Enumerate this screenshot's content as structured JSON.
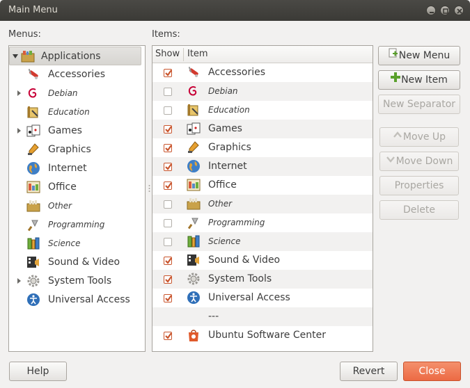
{
  "window": {
    "title": "Main Menu"
  },
  "menus_label": "Menus:",
  "items_label": "Items:",
  "menus": {
    "root": {
      "label": "Applications",
      "icon": "applications-folder-icon",
      "expanded": true
    },
    "children": [
      {
        "label": "Accessories",
        "icon": "accessories-icon",
        "italic": false,
        "expander": false
      },
      {
        "label": "Debian",
        "icon": "debian-swirl-icon",
        "italic": true,
        "expander": true
      },
      {
        "label": "Education",
        "icon": "education-icon",
        "italic": true,
        "expander": false
      },
      {
        "label": "Games",
        "icon": "games-cards-icon",
        "italic": false,
        "expander": true
      },
      {
        "label": "Graphics",
        "icon": "graphics-icon",
        "italic": false,
        "expander": false
      },
      {
        "label": "Internet",
        "icon": "internet-globe-icon",
        "italic": false,
        "expander": false
      },
      {
        "label": "Office",
        "icon": "office-icon",
        "italic": false,
        "expander": false
      },
      {
        "label": "Other",
        "icon": "other-folder-icon",
        "italic": true,
        "expander": false
      },
      {
        "label": "Programming",
        "icon": "programming-trowel-icon",
        "italic": true,
        "expander": false
      },
      {
        "label": "Science",
        "icon": "science-icon",
        "italic": true,
        "expander": false
      },
      {
        "label": "Sound & Video",
        "icon": "sound-video-icon",
        "italic": false,
        "expander": false
      },
      {
        "label": "System Tools",
        "icon": "system-tools-gear-icon",
        "italic": false,
        "expander": true
      },
      {
        "label": "Universal Access",
        "icon": "universal-access-icon",
        "italic": false,
        "expander": false
      }
    ]
  },
  "items": {
    "columns": {
      "show": "Show",
      "item": "Item"
    },
    "rows": [
      {
        "show": true,
        "label": "Accessories",
        "icon": "accessories-icon",
        "italic": false
      },
      {
        "show": false,
        "label": "Debian",
        "icon": "debian-swirl-icon",
        "italic": true
      },
      {
        "show": false,
        "label": "Education",
        "icon": "education-icon",
        "italic": true
      },
      {
        "show": true,
        "label": "Games",
        "icon": "games-cards-icon",
        "italic": false
      },
      {
        "show": true,
        "label": "Graphics",
        "icon": "graphics-icon",
        "italic": false
      },
      {
        "show": true,
        "label": "Internet",
        "icon": "internet-globe-icon",
        "italic": false
      },
      {
        "show": true,
        "label": "Office",
        "icon": "office-icon",
        "italic": false
      },
      {
        "show": false,
        "label": "Other",
        "icon": "other-folder-icon",
        "italic": true
      },
      {
        "show": false,
        "label": "Programming",
        "icon": "programming-trowel-icon",
        "italic": true
      },
      {
        "show": false,
        "label": "Science",
        "icon": "science-icon",
        "italic": true
      },
      {
        "show": true,
        "label": "Sound & Video",
        "icon": "sound-video-icon",
        "italic": false
      },
      {
        "show": true,
        "label": "System Tools",
        "icon": "system-tools-gear-icon",
        "italic": false
      },
      {
        "show": true,
        "label": "Universal Access",
        "icon": "universal-access-icon",
        "italic": false
      },
      {
        "separator": true,
        "label": "---"
      },
      {
        "show": true,
        "label": "Ubuntu Software Center",
        "icon": "software-center-bag-icon",
        "italic": false
      }
    ]
  },
  "buttons": {
    "new_menu": "New Menu",
    "new_item": "New Item",
    "new_separator": "New Separator",
    "move_up": "Move Up",
    "move_down": "Move Down",
    "properties": "Properties",
    "delete": "Delete",
    "help": "Help",
    "revert": "Revert",
    "close": "Close"
  },
  "colors": {
    "accent": "#ec6a44",
    "checkbox_check": "#c9552d",
    "titlebar": "#3c3b37"
  }
}
